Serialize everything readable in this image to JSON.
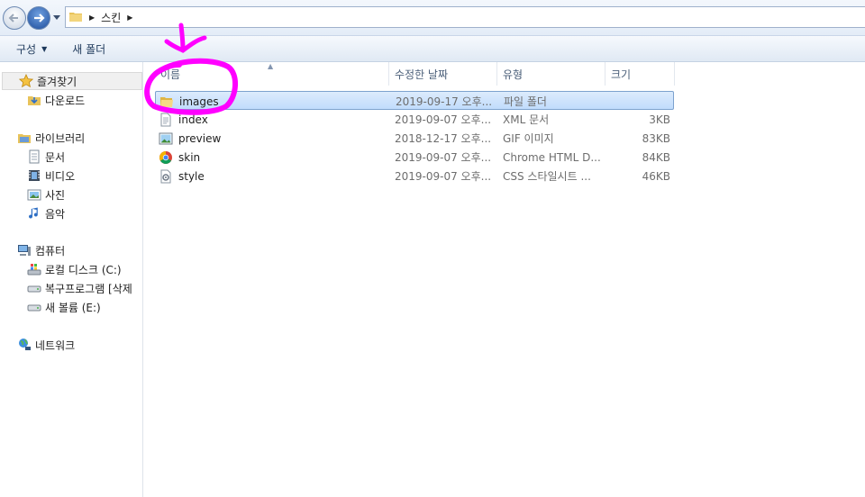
{
  "address": {
    "path": [
      "스킨"
    ],
    "icons": {
      "back": "back-arrow-icon",
      "forward": "forward-arrow-icon",
      "folder": "folder-icon"
    }
  },
  "toolbar": {
    "organize_label": "구성",
    "new_folder_label": "새 폴더"
  },
  "nav": {
    "favorites": {
      "label": "즐겨찾기",
      "icon": "star-icon"
    },
    "favorites_items": [
      {
        "label": "다운로드",
        "icon": "downloads-folder-icon"
      }
    ],
    "libraries": {
      "label": "라이브러리",
      "icon": "library-icon"
    },
    "libraries_items": [
      {
        "label": "문서",
        "icon": "documents-icon"
      },
      {
        "label": "비디오",
        "icon": "video-icon"
      },
      {
        "label": "사진",
        "icon": "pictures-icon"
      },
      {
        "label": "음악",
        "icon": "music-icon"
      }
    ],
    "computer": {
      "label": "컴퓨터",
      "icon": "computer-icon"
    },
    "computer_items": [
      {
        "label": "로컬 디스크 (C:)",
        "icon": "local-disk-icon"
      },
      {
        "label": "복구프로그램 [삭제",
        "icon": "drive-icon"
      },
      {
        "label": "새 볼륨 (E:)",
        "icon": "drive-icon"
      }
    ],
    "network": {
      "label": "네트워크",
      "icon": "network-icon"
    }
  },
  "columns": {
    "name": "이름",
    "date": "수정한 날짜",
    "type": "유형",
    "size": "크기"
  },
  "files": [
    {
      "name": "images",
      "date": "2019-09-17 오후...",
      "type": "파일 폴더",
      "size": "",
      "icon": "folder-icon",
      "selected": true
    },
    {
      "name": "index",
      "date": "2019-09-07 오후...",
      "type": "XML 문서",
      "size": "3KB",
      "icon": "xml-file-icon"
    },
    {
      "name": "preview",
      "date": "2018-12-17 오후...",
      "type": "GIF 이미지",
      "size": "83KB",
      "icon": "image-file-icon"
    },
    {
      "name": "skin",
      "date": "2019-09-07 오후...",
      "type": "Chrome HTML D...",
      "size": "84KB",
      "icon": "chrome-icon"
    },
    {
      "name": "style",
      "date": "2019-09-07 오후...",
      "type": "CSS 스타일시트 ...",
      "size": "46KB",
      "icon": "css-file-icon"
    }
  ],
  "colors": {
    "annotation": "#ff00ff",
    "selection": "#c1dcfc",
    "header_text": "#4c607a"
  }
}
